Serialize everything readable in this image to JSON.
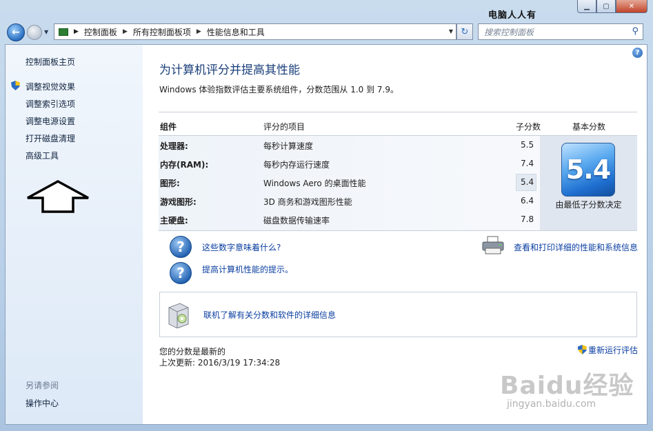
{
  "window": {
    "watermark_title": "电脑人人有",
    "buttons": {
      "minimize": "▁",
      "maximize": "▢",
      "close": "✕"
    }
  },
  "nav": {
    "breadcrumb": [
      "控制面板",
      "所有控制面板项",
      "性能信息和工具"
    ],
    "search_placeholder": "搜索控制面板"
  },
  "sidebar": {
    "home": "控制面板主页",
    "items": [
      "调整视觉效果",
      "调整索引选项",
      "调整电源设置",
      "打开磁盘清理",
      "高级工具"
    ],
    "see_also_heading": "另请参阅",
    "see_also_items": [
      "操作中心"
    ]
  },
  "main": {
    "title": "为计算机评分并提高其性能",
    "subtitle": "Windows 体验指数评估主要系统组件，分数范围从 1.0 到 7.9。",
    "table": {
      "headers": {
        "component": "组件",
        "rated_item": "评分的项目",
        "subscore": "子分数",
        "base_score": "基本分数"
      },
      "rows": [
        {
          "component": "处理器:",
          "item": "每秒计算速度",
          "score": "5.5"
        },
        {
          "component": "内存(RAM):",
          "item": "每秒内存运行速度",
          "score": "7.4"
        },
        {
          "component": "图形:",
          "item": "Windows Aero 的桌面性能",
          "score": "5.4"
        },
        {
          "component": "游戏图形:",
          "item": "3D 商务和游戏图形性能",
          "score": "6.4"
        },
        {
          "component": "主硬盘:",
          "item": "磁盘数据传输速率",
          "score": "7.8"
        }
      ],
      "base_score": "5.4",
      "base_caption": "由最低子分数决定"
    },
    "links": {
      "what_numbers_mean": "这些数字意味着什么?",
      "tips": "提高计算机性能的提示。",
      "view_print": "查看和打印详细的性能和系统信息",
      "online_info": "联机了解有关分数和软件的详细信息"
    },
    "status": {
      "current": "您的分数是最新的",
      "last_update_label": "上次更新: 2016/3/19 17:34:28",
      "rerun": "重新运行评估"
    }
  },
  "watermark": {
    "brand": "Baidu经验",
    "url": "jingyan.baidu.com"
  }
}
